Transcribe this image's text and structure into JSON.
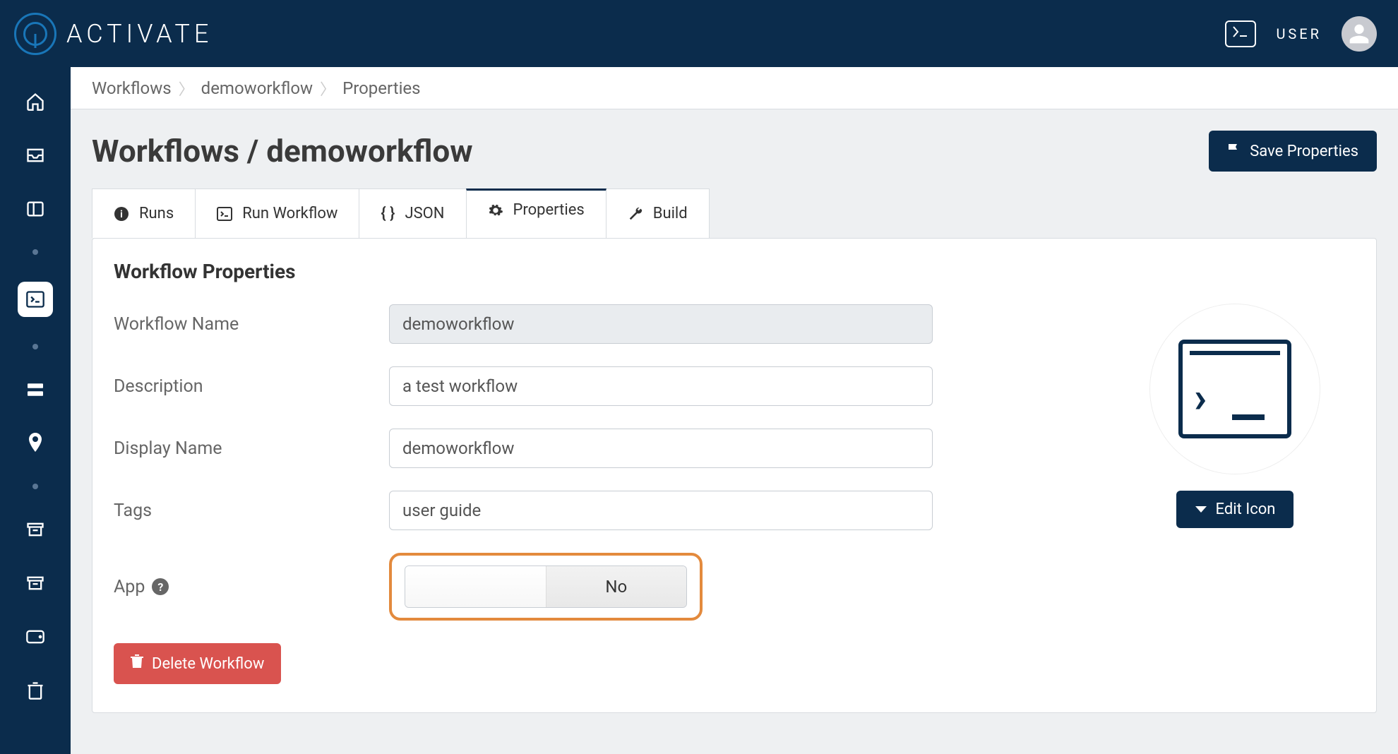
{
  "header": {
    "brand": "ACTIVATE",
    "user_label": "USER"
  },
  "breadcrumb": {
    "items": [
      "Workflows",
      "demoworkflow",
      "Properties"
    ]
  },
  "page": {
    "title": "Workflows / demoworkflow",
    "save_button": "Save Properties"
  },
  "tabs": {
    "items": [
      {
        "label": "Runs"
      },
      {
        "label": "Run Workflow"
      },
      {
        "label": "JSON"
      },
      {
        "label": "Properties",
        "active": true
      },
      {
        "label": "Build"
      }
    ]
  },
  "panel": {
    "title": "Workflow Properties",
    "fields": {
      "workflow_name": {
        "label": "Workflow Name",
        "value": "demoworkflow"
      },
      "description": {
        "label": "Description",
        "value": "a test workflow"
      },
      "display_name": {
        "label": "Display Name",
        "value": "demoworkflow"
      },
      "tags": {
        "label": "Tags",
        "value": "user guide"
      },
      "app": {
        "label": "App",
        "value": "No"
      }
    },
    "delete_button": "Delete Workflow",
    "edit_icon_button": "Edit Icon"
  }
}
